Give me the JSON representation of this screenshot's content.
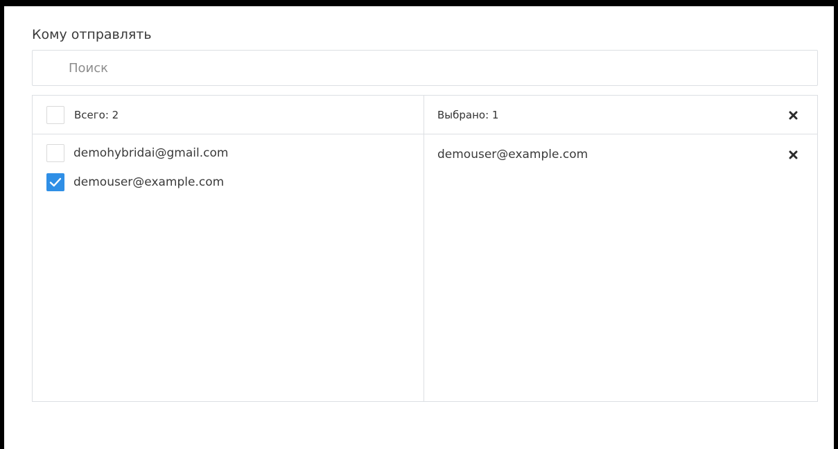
{
  "section": {
    "title": "Кому отправлять"
  },
  "search": {
    "placeholder": "Поиск",
    "value": ""
  },
  "source_panel": {
    "header_label": "Всего: 2",
    "select_all_checked": false,
    "items": [
      {
        "email": "demohybridai@gmail.com",
        "checked": false
      },
      {
        "email": "demouser@example.com",
        "checked": true
      }
    ]
  },
  "target_panel": {
    "header_label": "Выбрано: 1",
    "clear_icon": "close-icon",
    "items": [
      {
        "email": "demouser@example.com",
        "remove_icon": "close-icon"
      }
    ]
  },
  "colors": {
    "accent": "#2f8fe6",
    "border": "#dcdfe3",
    "text": "#333333",
    "placeholder": "#8c8c8c"
  }
}
